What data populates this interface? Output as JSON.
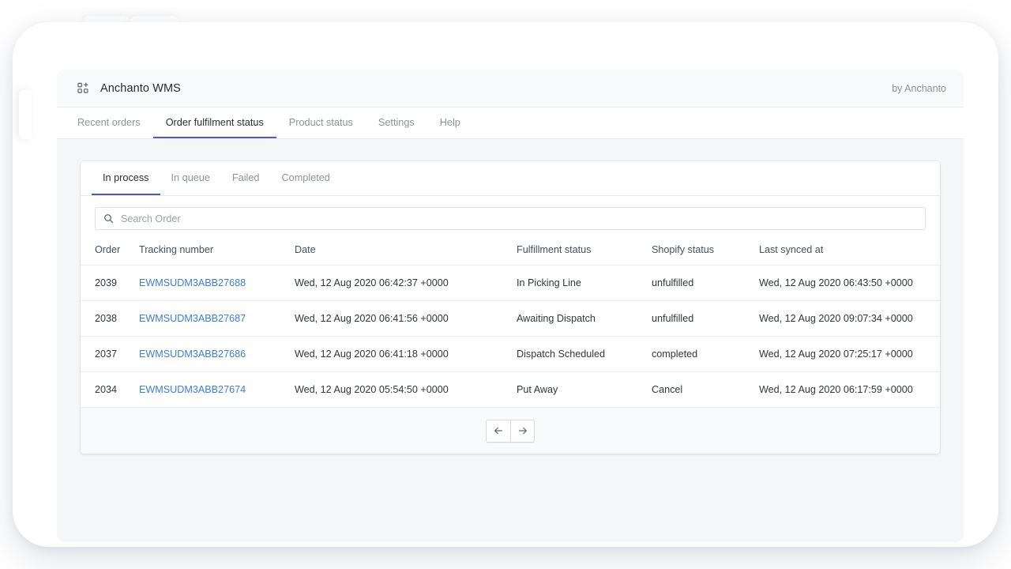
{
  "app": {
    "logo_icon": "apps-grid-add-icon",
    "title": "Anchanto WMS",
    "by_label": "by Anchanto"
  },
  "nav": {
    "items": [
      {
        "label": "Recent orders",
        "active": false
      },
      {
        "label": "Order fulfilment status",
        "active": true
      },
      {
        "label": "Product status",
        "active": false
      },
      {
        "label": "Settings",
        "active": false
      },
      {
        "label": "Help",
        "active": false
      }
    ]
  },
  "card": {
    "tabs": [
      {
        "label": "In process",
        "active": true
      },
      {
        "label": "In queue",
        "active": false
      },
      {
        "label": "Failed",
        "active": false
      },
      {
        "label": "Completed",
        "active": false
      }
    ],
    "search": {
      "icon": "search-icon",
      "placeholder": "Search Order",
      "value": ""
    },
    "table": {
      "columns": [
        "Order",
        "Tracking number",
        "Date",
        "Fulfillment status",
        "Shopify status",
        "Last synced at"
      ],
      "rows": [
        {
          "order": "2039",
          "tracking": "EWMSUDM3ABB27688",
          "date": "Wed, 12 Aug 2020 06:42:37 +0000",
          "fulfillment": "In Picking Line",
          "shopify": "unfulfilled",
          "synced": "Wed, 12 Aug 2020 06:43:50 +0000"
        },
        {
          "order": "2038",
          "tracking": "EWMSUDM3ABB27687",
          "date": "Wed, 12 Aug 2020 06:41:56 +0000",
          "fulfillment": "Awaiting Dispatch",
          "shopify": "unfulfilled",
          "synced": "Wed, 12 Aug 2020 09:07:34 +0000"
        },
        {
          "order": "2037",
          "tracking": "EWMSUDM3ABB27686",
          "date": "Wed, 12 Aug 2020 06:41:18 +0000",
          "fulfillment": "Dispatch Scheduled",
          "shopify": "completed",
          "synced": "Wed, 12 Aug 2020 07:25:17 +0000"
        },
        {
          "order": "2034",
          "tracking": "EWMSUDM3ABB27674",
          "date": "Wed, 12 Aug 2020 05:54:50 +0000",
          "fulfillment": "Put Away",
          "shopify": "Cancel",
          "synced": "Wed, 12 Aug 2020 06:17:59 +0000"
        }
      ]
    },
    "pagination": {
      "prev_icon": "arrow-left-icon",
      "next_icon": "arrow-right-icon"
    }
  },
  "colors": {
    "accent": "#4b57c8",
    "link": "#3d7ddb",
    "page_bg": "#f4f6f8",
    "header_bg": "#f9fafb",
    "border": "#e7e9ec",
    "text": "#31373d",
    "muted": "#8d949e"
  }
}
